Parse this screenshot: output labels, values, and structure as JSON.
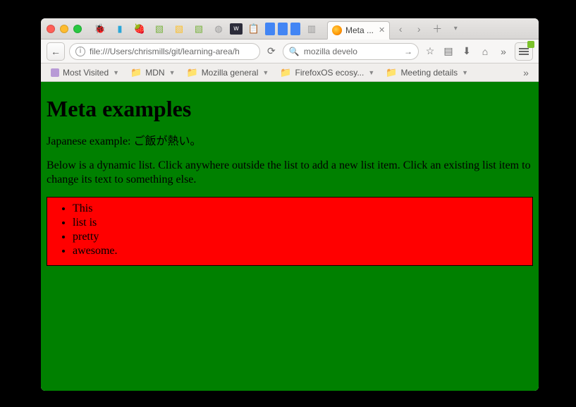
{
  "window": {
    "tab_title": "Meta ..."
  },
  "urlbar": {
    "url": "file:///Users/chrismills/git/learning-area/h",
    "search_placeholder": "mozilla develo"
  },
  "bookmarks": {
    "items": [
      {
        "label": "Most Visited",
        "icon": "star"
      },
      {
        "label": "MDN",
        "icon": "folder"
      },
      {
        "label": "Mozilla general",
        "icon": "folder"
      },
      {
        "label": "FirefoxOS ecosy...",
        "icon": "folder"
      },
      {
        "label": "Meeting details",
        "icon": "folder"
      }
    ]
  },
  "page": {
    "heading": "Meta examples",
    "jp_line": "Japanese example: ご飯が熱い。",
    "instructions": "Below is a dynamic list. Click anywhere outside the list to add a new list item. Click an existing list item to change its text to something else.",
    "list": [
      "This",
      "list is",
      "pretty",
      "awesome."
    ]
  }
}
